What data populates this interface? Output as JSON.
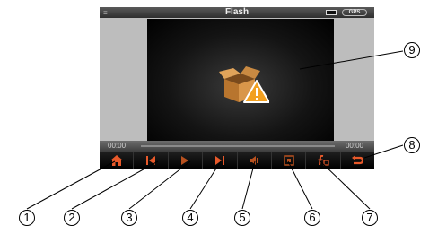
{
  "title": "Flash",
  "status": {
    "gps_label": "GPS"
  },
  "player": {
    "time_start": "00:00",
    "time_end": "00:00"
  },
  "controls": [
    {
      "name": "home-button",
      "icon": "home-icon",
      "color": "#e8592a"
    },
    {
      "name": "previous-button",
      "icon": "skip-back-icon",
      "color": "#e8592a"
    },
    {
      "name": "play-button",
      "icon": "play-icon",
      "color": "#e8592a"
    },
    {
      "name": "next-button",
      "icon": "skip-forward-icon",
      "color": "#e8592a"
    },
    {
      "name": "volume-button",
      "icon": "speaker-icon",
      "color": "#e8592a"
    },
    {
      "name": "fullscreen-button",
      "icon": "fullscreen-icon",
      "color": "#e8592a"
    },
    {
      "name": "file-button",
      "icon": "file-f-icon",
      "color": "#e8592a"
    },
    {
      "name": "back-button",
      "icon": "return-icon",
      "color": "#e8592a"
    }
  ],
  "callouts": [
    "1",
    "2",
    "3",
    "4",
    "5",
    "6",
    "7",
    "8",
    "9"
  ],
  "colors": {
    "accent": "#e8592a",
    "video_bg": "#141414",
    "screen_bg": "#bdbdbd"
  }
}
